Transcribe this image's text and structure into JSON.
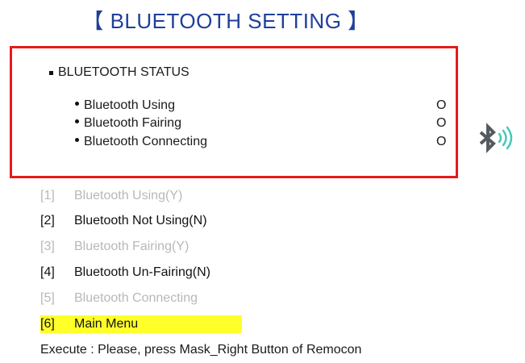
{
  "title": "【 BLUETOOTH  SETTING 】",
  "status": {
    "heading": "BLUETOOTH STATUS",
    "rows": [
      {
        "label": "Bluetooth Using",
        "value": "O"
      },
      {
        "label": "Bluetooth Fairing",
        "value": "O"
      },
      {
        "label": "Bluetooth Connecting",
        "value": "O"
      }
    ]
  },
  "icon": "bluetooth-signal-icon",
  "menu": [
    {
      "num": "[1]",
      "label": "Bluetooth Using(Y)",
      "state": "disabled"
    },
    {
      "num": "[2]",
      "label": "Bluetooth Not Using(N)",
      "state": "active"
    },
    {
      "num": "[3]",
      "label": "Bluetooth Fairing(Y)",
      "state": "disabled"
    },
    {
      "num": "[4]",
      "label": "Bluetooth Un-Fairing(N)",
      "state": "active"
    },
    {
      "num": "[5]",
      "label": "Bluetooth Connecting",
      "state": "disabled"
    },
    {
      "num": "[6]",
      "label": "Main Menu",
      "state": "selected"
    }
  ],
  "footer": "Execute : Please, press Mask_Right Button of Remocon",
  "colors": {
    "title": "#1f3f9a",
    "box_border": "#e41b1b",
    "highlight": "#ffff2a",
    "disabled_text": "#b8b8b8",
    "icon_wave": "#44c9b8"
  }
}
